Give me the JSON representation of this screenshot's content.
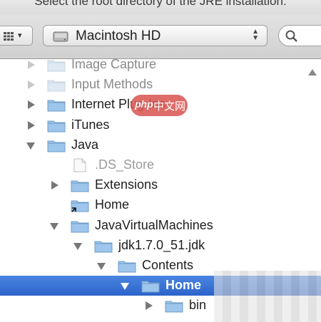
{
  "window": {
    "title": "Select the root directory of the JRE installation:"
  },
  "toolbar": {
    "view_arrow": "▾",
    "location_label": "Macintosh HD",
    "location_stepper": "▲▼"
  },
  "tree": {
    "rows": [
      {
        "label": "Image Capture",
        "state": "faded"
      },
      {
        "label": "Input Methods",
        "state": "faded"
      },
      {
        "label": "Internet Plug-Ins",
        "state": "closed"
      },
      {
        "label": "iTunes",
        "state": "closed"
      },
      {
        "label": "Java",
        "state": "open"
      },
      {
        "label": ".DS_Store",
        "state": "file"
      },
      {
        "label": "Extensions",
        "state": "closed"
      },
      {
        "label": "Home",
        "state": "alias"
      },
      {
        "label": "JavaVirtualMachines",
        "state": "open"
      },
      {
        "label": "jdk1.7.0_51.jdk",
        "state": "open"
      },
      {
        "label": "Contents",
        "state": "open"
      },
      {
        "label": "Home",
        "state": "selected"
      },
      {
        "label": "bin",
        "state": "closed"
      }
    ]
  },
  "watermark": {
    "badge": "php",
    "text": "中文网"
  },
  "colors": {
    "selection": "#2c63c9",
    "folder": "#9ec6ec"
  }
}
